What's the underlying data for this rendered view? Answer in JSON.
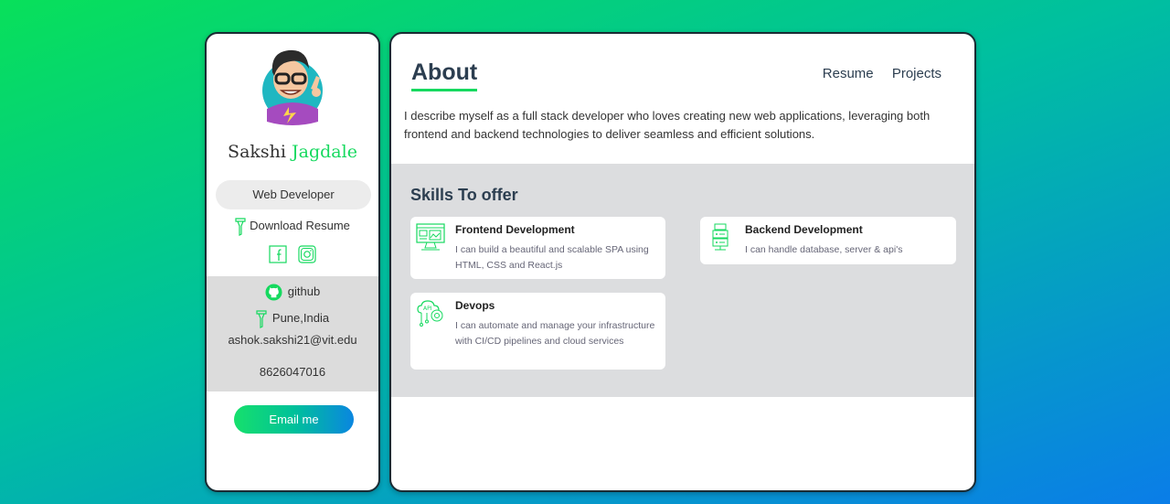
{
  "profile": {
    "first_name": "Sakshi",
    "last_name": "Jagdale",
    "role": "Web Developer",
    "download_label": "Download Resume"
  },
  "contact": {
    "github_label": "github",
    "location": "Pune,India",
    "email": "ashok.sakshi21@vit.edu",
    "phone": "8626047016",
    "email_button": "Email me"
  },
  "nav": {
    "title": "About",
    "links": [
      "Resume",
      "Projects"
    ]
  },
  "about": {
    "text": "I describe myself as a full stack developer who loves creating new web applications, leveraging both frontend and backend technologies to deliver seamless and efficient solutions."
  },
  "skills": {
    "title": "Skills To offer",
    "items": [
      {
        "title": "Frontend Development",
        "desc": "I can build a beautiful and scalable SPA using HTML, CSS and React.js",
        "icon": "monitor-icon"
      },
      {
        "title": "Backend Development",
        "desc": "I can handle database, server & api's",
        "icon": "server-icon"
      },
      {
        "title": "Devops",
        "desc": "I can automate and manage your infrastructure with CI/CD pipelines and cloud services",
        "icon": "cloud-api-icon"
      }
    ]
  },
  "colors": {
    "accent": "#16d95f",
    "heading": "#2c3e50",
    "panel_gray": "#dcdddf"
  }
}
